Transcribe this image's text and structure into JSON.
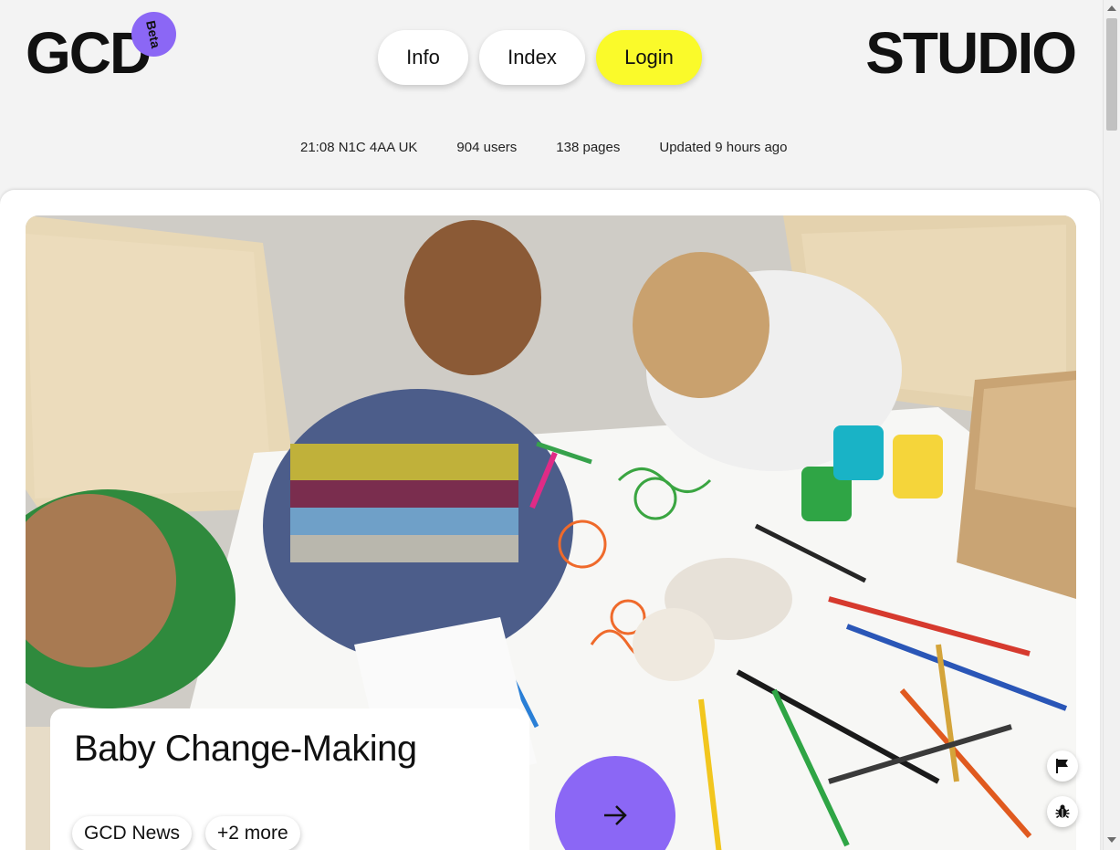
{
  "header": {
    "logo": "GCD",
    "beta_badge": "Beta",
    "nav": [
      {
        "label": "Info"
      },
      {
        "label": "Index"
      },
      {
        "label": "Login"
      }
    ],
    "studio": "STUDIO"
  },
  "stats": {
    "time_location": "21:08 N1C 4AA UK",
    "users": "904 users",
    "pages": "138 pages",
    "updated": "Updated 9 hours ago"
  },
  "feature": {
    "title": "Baby Change-Making",
    "tags": [
      "GCD News",
      "+2 more"
    ],
    "image_icon": "photo-children-drawing",
    "arrow_icon": "arrow-right-icon"
  },
  "floating": {
    "flag_icon": "flag-icon",
    "bug_icon": "bug-icon"
  },
  "colors": {
    "accent_purple": "#8b67f5",
    "login_yellow": "#fafa2a",
    "background": "#f3f3f3"
  }
}
